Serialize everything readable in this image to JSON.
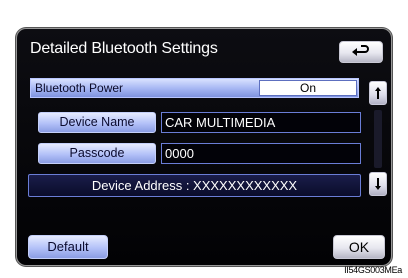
{
  "header": {
    "title": "Detailed Bluetooth Settings"
  },
  "bluetooth_power": {
    "label": "Bluetooth Power",
    "value": "On"
  },
  "device_name": {
    "label": "Device Name",
    "value": "CAR MULTIMEDIA"
  },
  "passcode": {
    "label": "Passcode",
    "value": "0000"
  },
  "device_address": {
    "text": "Device Address : XXXXXXXXXXXX"
  },
  "footer": {
    "default_label": "Default",
    "ok_label": "OK"
  },
  "figure_code": "II54GS003MEa",
  "icons": {
    "back": "back-arrow-icon",
    "up": "scroll-up-icon",
    "down": "scroll-down-icon"
  }
}
